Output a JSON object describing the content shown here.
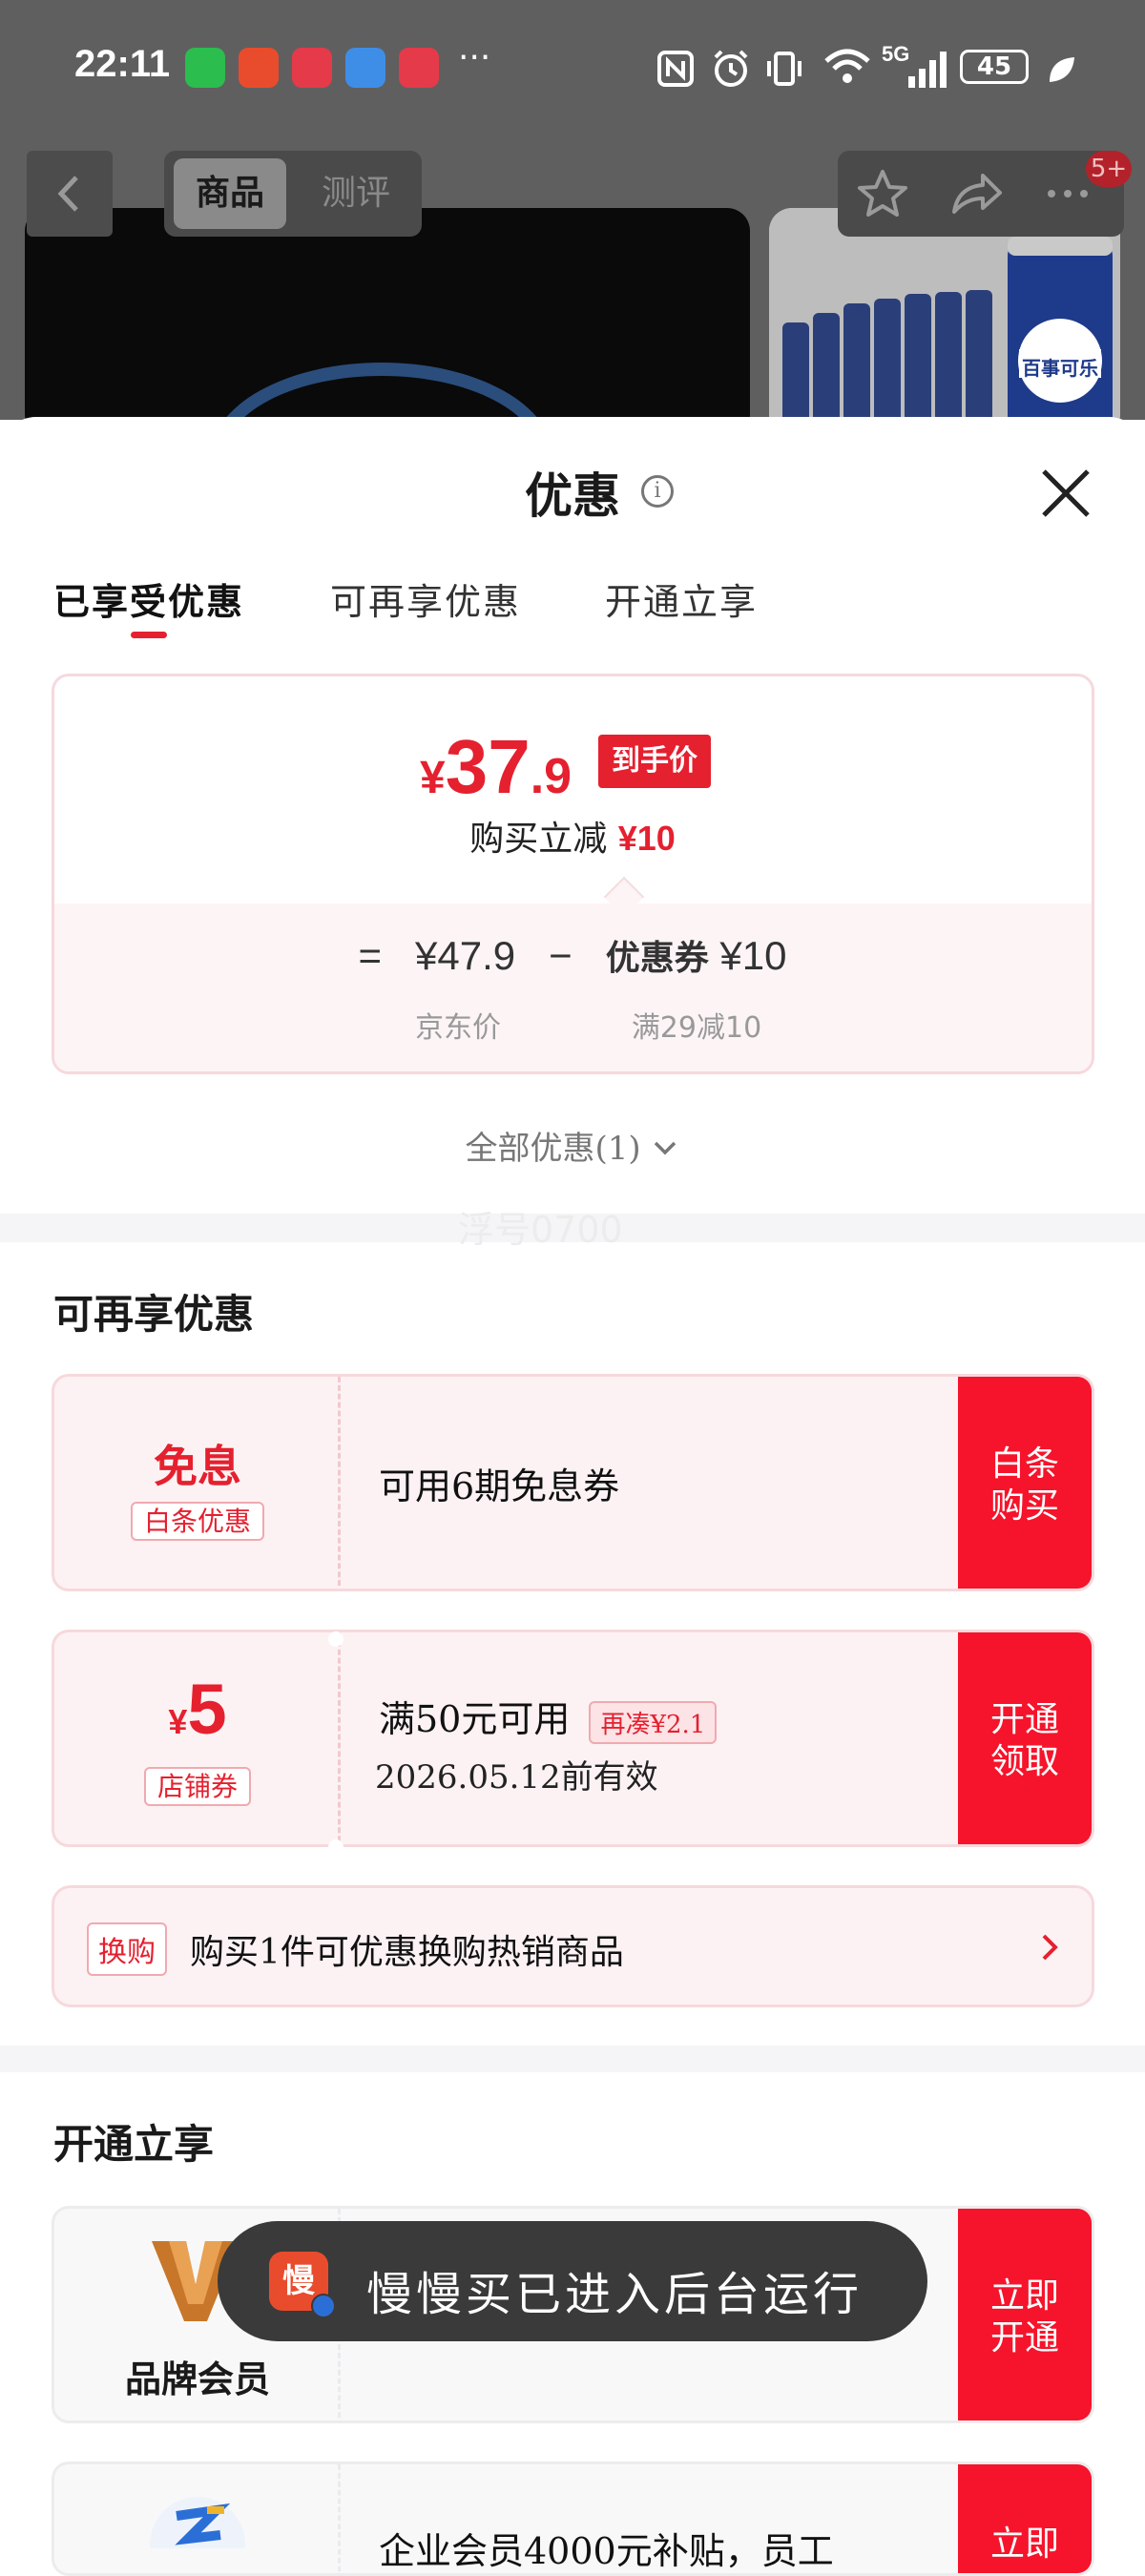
{
  "status_bar": {
    "time": "22:11",
    "more": "···",
    "network": "5G",
    "battery": "45"
  },
  "nav": {
    "tabs": [
      "商品",
      "测评"
    ],
    "badge": "5+"
  },
  "product": {
    "can_label": "百事可乐"
  },
  "sheet": {
    "title": "优惠",
    "tabs": [
      "已享受优惠",
      "可再享优惠",
      "开通立享"
    ],
    "price": {
      "currency": "¥",
      "integer": "37",
      "decimal": ".9",
      "tag": "到手价",
      "instant_text": "购买立减",
      "instant_amount": "¥10",
      "equals": "=",
      "jd_price": "¥47.9",
      "minus": "−",
      "coupon_text": "优惠券",
      "coupon_amount": "¥10",
      "jd_label": "京东价",
      "coupon_rule": "满29减10"
    },
    "all_offers": "全部优惠(1)",
    "watermark": "浮号0700"
  },
  "more_offers": {
    "title": "可再享优惠",
    "baitiao": {
      "big": "免息",
      "tag": "白条优惠",
      "text": "可用6期免息券",
      "button": [
        "白条",
        "购买"
      ]
    },
    "shop_coupon": {
      "currency": "¥",
      "amount": "5",
      "tag": "店铺券",
      "text": "满50元可用",
      "addon": "再凑¥2.1",
      "validity": "2026.05.12前有效",
      "button": [
        "开通",
        "领取"
      ]
    },
    "exchange": {
      "tag": "换购",
      "text": "购买1件可优惠换购热销商品"
    }
  },
  "open_enjoy": {
    "title": "开通立享",
    "brand_member": {
      "label": "品牌会员",
      "button": [
        "立即",
        "开通"
      ]
    },
    "enterprise": {
      "text": "企业会员4000元补贴，员工",
      "button": [
        "立即"
      ]
    }
  },
  "toast": {
    "icon_char": "慢",
    "text": "慢慢买已进入后台运行"
  },
  "colors": {
    "accent": "#e5202f",
    "button_red": "#f5142b",
    "card_bg": "#fcf2f3"
  }
}
